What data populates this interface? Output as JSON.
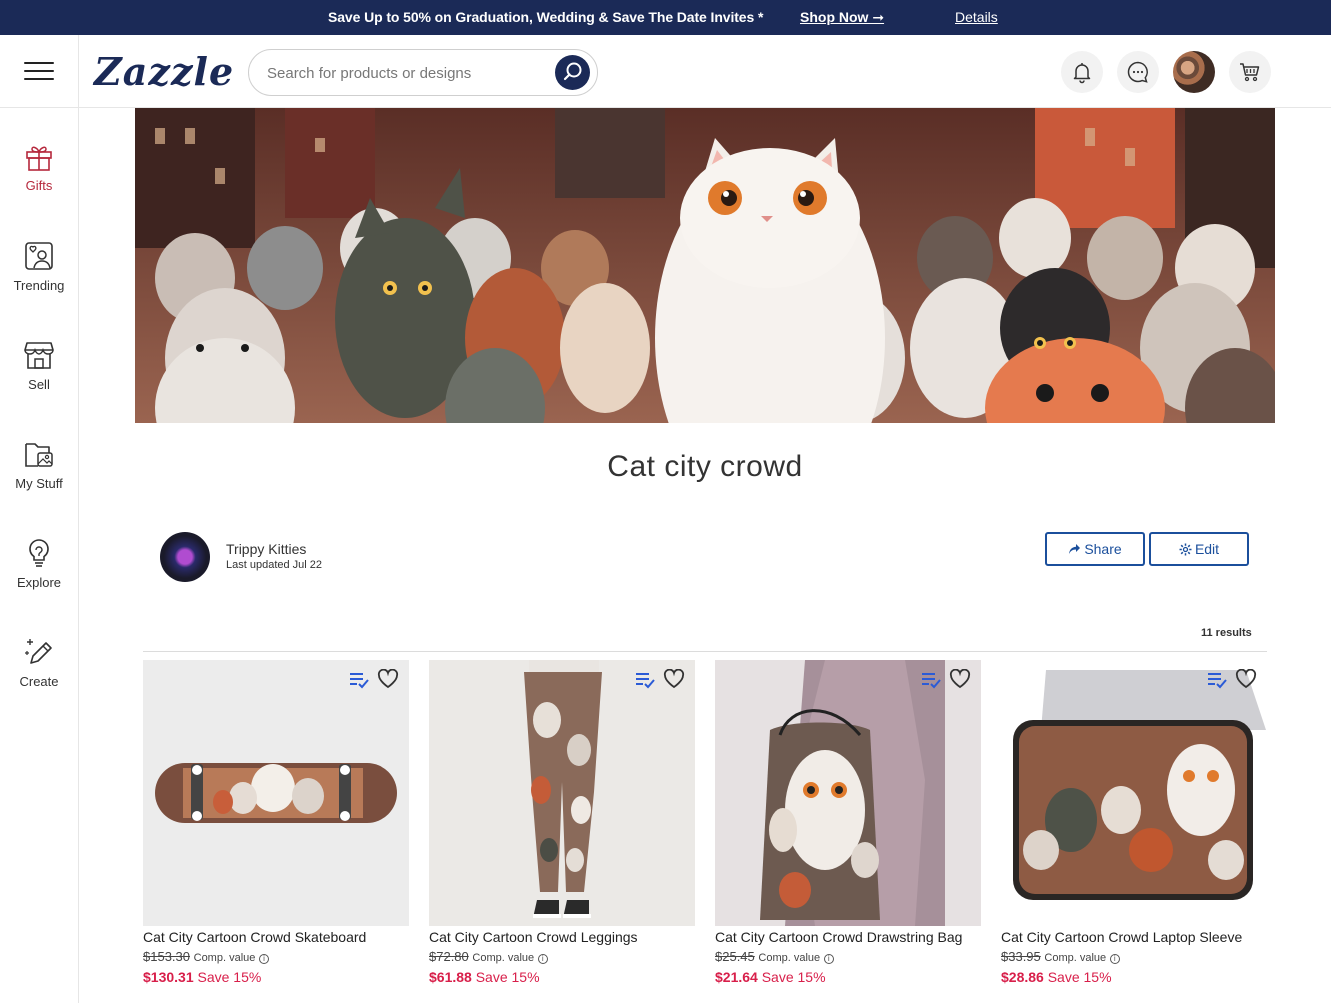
{
  "promo": {
    "message": "Save Up to 50% on Graduation, Wedding & Save The Date Invites *",
    "shop_now": "Shop Now ➞",
    "details": "Details"
  },
  "header": {
    "logo": "Zazzle",
    "search_placeholder": "Search for products or designs",
    "icons": [
      "bell-icon",
      "chat-icon",
      "avatar",
      "cart-icon"
    ]
  },
  "sidebar": {
    "items": [
      {
        "label": "Gifts",
        "icon": "gift-icon"
      },
      {
        "label": "Trending",
        "icon": "trending-icon"
      },
      {
        "label": "Sell",
        "icon": "store-icon"
      },
      {
        "label": "My Stuff",
        "icon": "folder-icon"
      },
      {
        "label": "Explore",
        "icon": "lightbulb-icon"
      },
      {
        "label": "Create",
        "icon": "pencil-sparkle-icon"
      }
    ]
  },
  "collection": {
    "title": "Cat city crowd",
    "author": "Trippy Kitties",
    "updated": "Last updated Jul 22",
    "share_label": "Share",
    "edit_label": "Edit",
    "results": "11 results"
  },
  "products": [
    {
      "name": "Cat City Cartoon Crowd Skateboard",
      "comp_price": "$153.30",
      "comp_label": "Comp. value",
      "price": "$130.31",
      "save": "Save 15%"
    },
    {
      "name": "Cat City Cartoon Crowd Leggings",
      "comp_price": "$72.80",
      "comp_label": "Comp. value",
      "price": "$61.88",
      "save": "Save 15%"
    },
    {
      "name": "Cat City Cartoon Crowd Drawstring Bag",
      "comp_price": "$25.45",
      "comp_label": "Comp. value",
      "price": "$21.64",
      "save": "Save 15%"
    },
    {
      "name": "Cat City Cartoon Crowd Laptop Sleeve",
      "comp_price": "$33.95",
      "comp_label": "Comp. value",
      "price": "$28.86",
      "save": "Save 15%"
    }
  ],
  "colors": {
    "brand_navy": "#1b2a57",
    "accent_blue": "#1b4f9c",
    "sale_red": "#d81f4a",
    "gifts_red": "#b5283c"
  }
}
